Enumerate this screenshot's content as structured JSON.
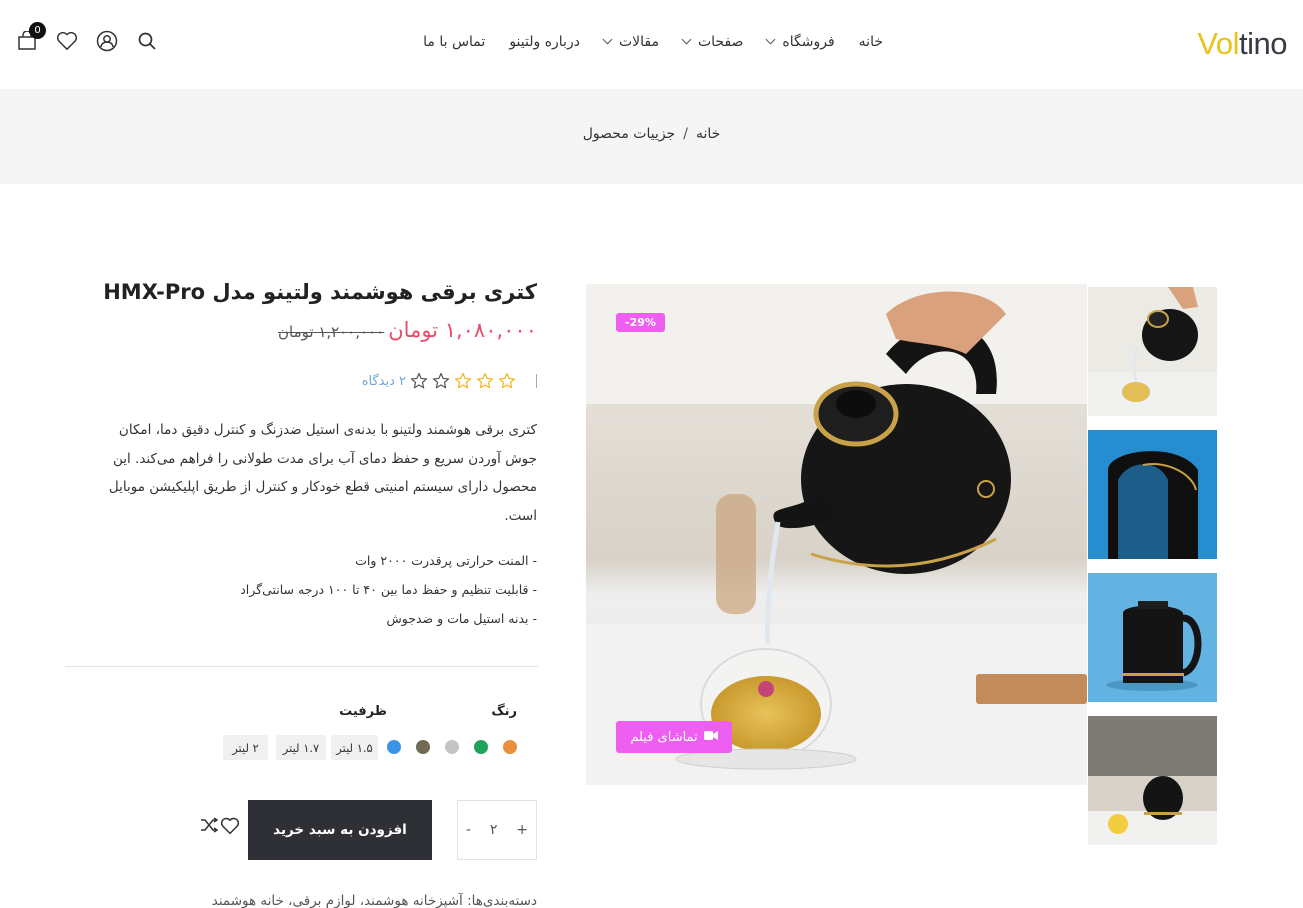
{
  "brand": {
    "part1": "Vol",
    "part2": "tino"
  },
  "nav": [
    {
      "label": "خانه",
      "has_dropdown": false
    },
    {
      "label": "فروشگاه",
      "has_dropdown": true
    },
    {
      "label": "صفحات",
      "has_dropdown": true
    },
    {
      "label": "مقالات",
      "has_dropdown": true
    },
    {
      "label": "درباره ولتینو",
      "has_dropdown": false
    },
    {
      "label": "تماس با ما",
      "has_dropdown": false
    }
  ],
  "header_icons": {
    "cart_count": "0"
  },
  "breadcrumb": {
    "home": "خانه",
    "separator": "/",
    "current": "جزییات محصول"
  },
  "gallery": {
    "discount_badge": "-29%",
    "video_label": "تماشای فیلم"
  },
  "product": {
    "title": "کتری برقی هوشمند ولتینو مدل HMX-Pro",
    "price_new": "۱,۰۸۰,۰۰۰ تومان",
    "price_old": "۱,۲۰۰,۰۰۰ تومان",
    "rating": {
      "filled": 3,
      "total": 5,
      "reviews_label": "۲ دیدگاه"
    },
    "description": "کتری برقی هوشمند ولتینو با بدنه‌ی استیل ضدزنگ و کنترل دقیق دما، امکان جوش آوردن سریع و حفظ دمای آب برای مدت طولانی را فراهم می‌کند. این محصول دارای سیستم امنیتی قطع خودکار و کنترل از طریق اپلیکیشن موبایل است.",
    "features": [
      "- المنت حرارتی پرقدرت ۲۰۰۰ وات",
      "- قابلیت تنظیم و حفظ دما بین ۴۰ تا ۱۰۰ درجه سانتی‌گراد",
      "- بدنه استیل مات و ضدجوش"
    ],
    "options": {
      "color_label": "رنگ",
      "colors": [
        "#e8903c",
        "#1fa35a",
        "#c4c4c4",
        "#726a52"
      ],
      "capacity_label": "ظرفیت",
      "capacity_selected_color": "#3b93e8",
      "capacities": [
        "۱.۵ لیتر",
        "۱.۷ لیتر",
        "۲ لیتر"
      ]
    },
    "quantity": "۲",
    "add_to_cart": "افزودن به سبد خرید",
    "categories": "دسته‌بندی‌ها: آشپزخانه هوشمند، لوازم برقی، خانه هوشمند"
  }
}
